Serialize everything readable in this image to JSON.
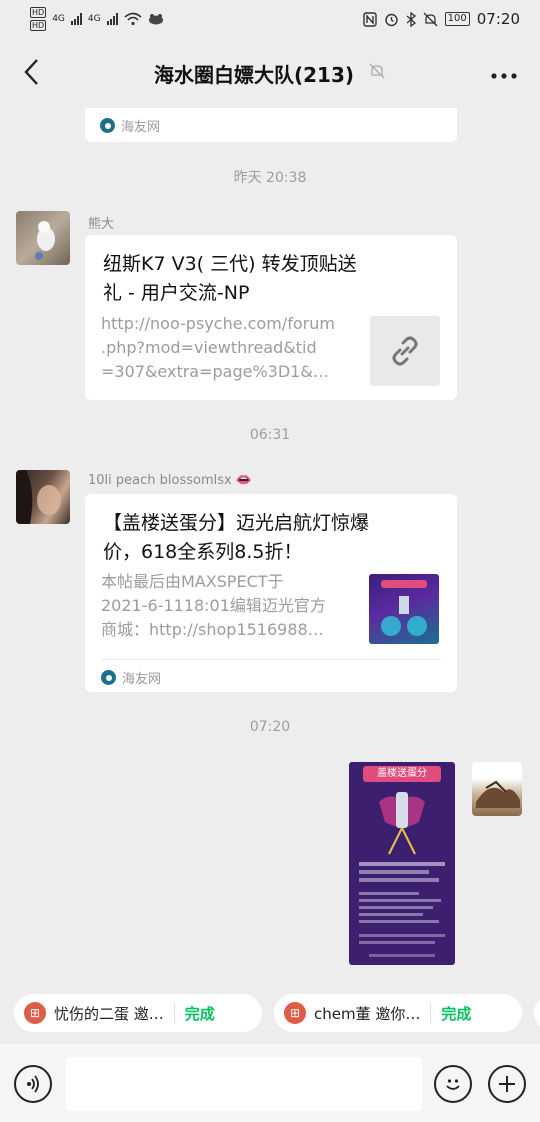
{
  "status": {
    "hd1": "HD",
    "hd2": "HD",
    "net1": "4G",
    "net2": "4G",
    "battery": "100",
    "time": "07:20"
  },
  "header": {
    "back_icon": "chevron-left-icon",
    "title": "海水圈白嫖大队(213)",
    "mute_icon": "bell-muted-icon",
    "more_icon": "more-horizontal-icon"
  },
  "messages": {
    "top_card_source": "海友网",
    "ts1": "昨天 20:38",
    "msg1": {
      "sender": "熊大",
      "title_line1": "纽斯K7 V3(  三代)  转发顶贴送",
      "title_line2": "礼 - 用户交流-NP",
      "desc_line1": "http://noo-psyche.com/forum",
      "desc_line2": ".php?mod=viewthread&tid",
      "desc_line3": "=307&extra=page%3D1&…",
      "thumb_icon": "link-icon"
    },
    "ts2": "06:31",
    "msg2": {
      "sender": "10li peach blossomlsx",
      "sender_emoji": "👄",
      "title_line1": "【盖楼送蛋分】迈光启航灯惊爆",
      "title_line2": "价，618全系列8.5折！",
      "desc_line1": "本帖最后由MAXSPECT于",
      "desc_line2": "2021-6-1118:01编辑迈光官方",
      "desc_line3": "商城：http://shop1516988…",
      "source": "海友网"
    },
    "ts3": "07:20",
    "poster_title": "盖楼送蛋分"
  },
  "actions": [
    {
      "label": "忧伤的二蛋 邀…",
      "done": "完成"
    },
    {
      "label": "chem董 邀你…",
      "done": "完成"
    }
  ],
  "inputbar": {
    "voice_icon": "voice-icon",
    "emoji_icon": "emoji-icon",
    "plus_icon": "plus-icon"
  },
  "colors": {
    "background": "#ededed",
    "accent_green": "#07c160",
    "poster_purple": "#3c1f6e"
  }
}
